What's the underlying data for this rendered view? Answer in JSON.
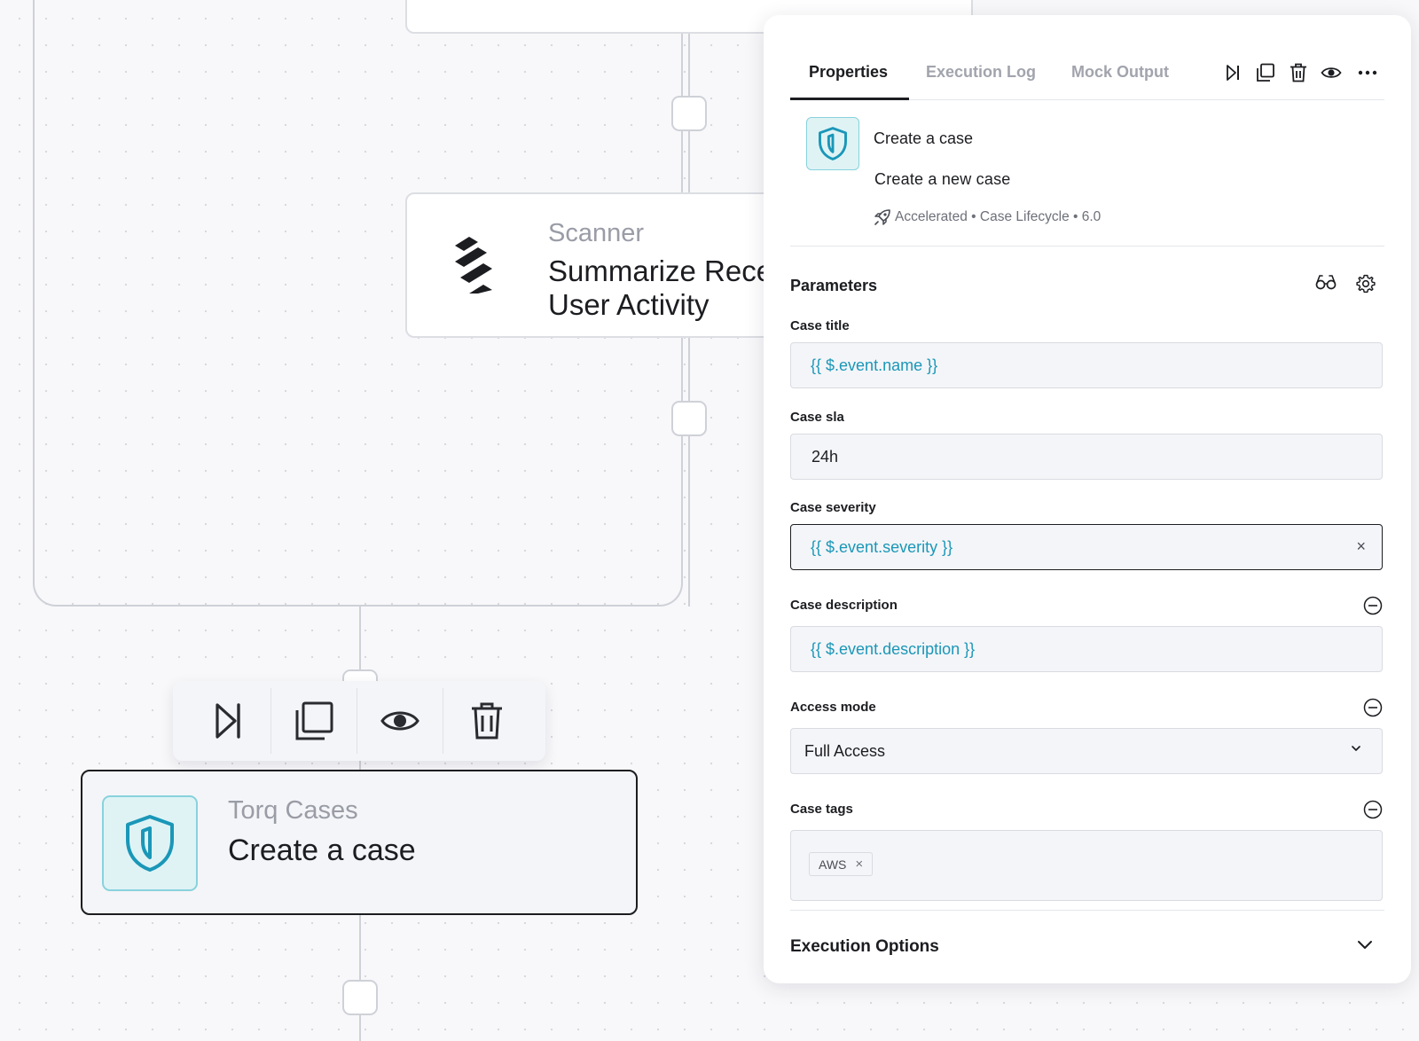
{
  "canvas": {
    "scanner_node": {
      "subtitle": "Scanner",
      "title_line1": "Summarize Recent",
      "title_line2": "User Activity",
      "logo_icon": "scanner-logo-icon"
    },
    "node_toolbar": {
      "icons": [
        "skip-forward-icon",
        "copy-icon",
        "eye-icon",
        "trash-icon"
      ]
    },
    "case_node": {
      "subtitle": "Torq Cases",
      "title": "Create a case",
      "icon": "shield-icon"
    }
  },
  "panel": {
    "tabs": [
      {
        "label": "Properties",
        "active": true
      },
      {
        "label": "Execution Log",
        "active": false
      },
      {
        "label": "Mock Output",
        "active": false
      }
    ],
    "tab_action_icons": [
      "skip-forward-icon",
      "copy-icon",
      "trash-icon",
      "eye-icon",
      "more-icon"
    ],
    "step": {
      "name": "Create a case",
      "description": "Create a new case",
      "meta": "Accelerated • Case Lifecycle • 6.0",
      "meta_icon": "rocket-icon"
    },
    "parameters": {
      "title": "Parameters",
      "tool_icons": [
        "glasses-icon",
        "gear-icon"
      ],
      "case_title": {
        "label": "Case title",
        "value": "{{ $.event.name }}"
      },
      "case_sla": {
        "label": "Case sla",
        "value": "24h"
      },
      "case_severity": {
        "label": "Case severity",
        "value": "{{ $.event.severity }}",
        "clear": "×"
      },
      "case_description": {
        "label": "Case description",
        "value": "{{ $.event.description }}"
      },
      "access_mode": {
        "label": "Access mode",
        "value": "Full Access"
      },
      "case_tags": {
        "label": "Case tags",
        "tags": [
          "AWS"
        ],
        "tag_remove": "×"
      }
    },
    "execution_options": {
      "label": "Execution Options"
    }
  },
  "colors": {
    "accent_teal": "#1a97b8",
    "badge_bg": "#dff3f5",
    "badge_border": "#88d2dc",
    "text_primary": "#1c1d21",
    "text_muted": "#a2a4ad"
  }
}
